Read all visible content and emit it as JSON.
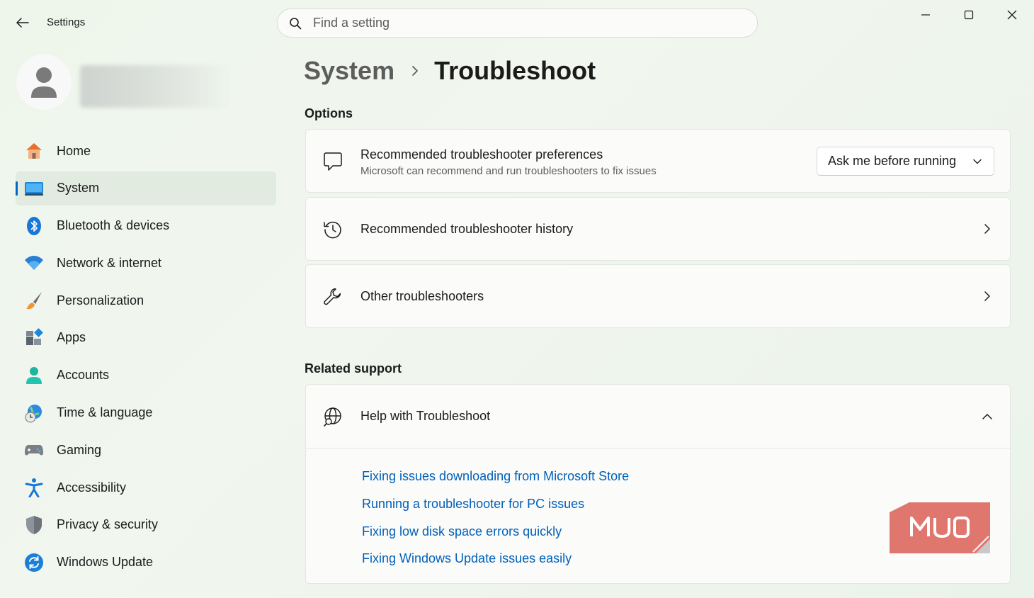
{
  "window": {
    "app_title": "Settings"
  },
  "search": {
    "placeholder": "Find a setting"
  },
  "sidebar": {
    "items": [
      {
        "label": "Home"
      },
      {
        "label": "System"
      },
      {
        "label": "Bluetooth & devices"
      },
      {
        "label": "Network & internet"
      },
      {
        "label": "Personalization"
      },
      {
        "label": "Apps"
      },
      {
        "label": "Accounts"
      },
      {
        "label": "Time & language"
      },
      {
        "label": "Gaming"
      },
      {
        "label": "Accessibility"
      },
      {
        "label": "Privacy & security"
      },
      {
        "label": "Windows Update"
      }
    ],
    "active_index": 1
  },
  "breadcrumb": {
    "parent": "System",
    "current": "Troubleshoot"
  },
  "options": {
    "section_title": "Options",
    "preferences": {
      "title": "Recommended troubleshooter preferences",
      "subtitle": "Microsoft can recommend and run troubleshooters to fix issues",
      "dropdown_value": "Ask me before running"
    },
    "history": {
      "title": "Recommended troubleshooter history"
    },
    "other": {
      "title": "Other troubleshooters"
    }
  },
  "related": {
    "section_title": "Related support",
    "help_title": "Help with Troubleshoot",
    "links": [
      {
        "label": "Fixing issues downloading from Microsoft Store"
      },
      {
        "label": "Running a troubleshooter for PC issues"
      },
      {
        "label": "Fixing low disk space errors quickly"
      },
      {
        "label": "Fixing Windows Update issues easily"
      }
    ]
  },
  "watermark": {
    "text": "MUO",
    "color": "#e0776f"
  },
  "colors": {
    "accent": "#0067c0",
    "link": "#0060b8"
  }
}
